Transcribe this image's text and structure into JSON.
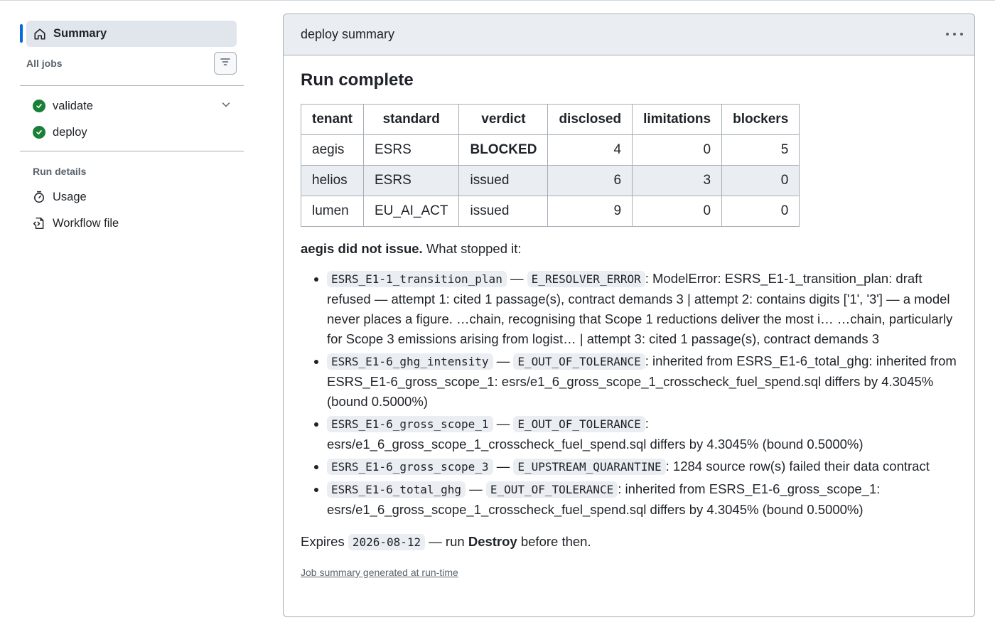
{
  "sidebar": {
    "summary_label": "Summary",
    "all_jobs_label": "All jobs",
    "jobs": [
      {
        "label": "validate",
        "status": "success"
      },
      {
        "label": "deploy",
        "status": "success"
      }
    ],
    "run_details_label": "Run details",
    "details": [
      {
        "label": "Usage",
        "icon": "stopwatch-icon"
      },
      {
        "label": "Workflow file",
        "icon": "file-code-icon"
      }
    ]
  },
  "card": {
    "title": "deploy summary",
    "heading": "Run complete",
    "table": {
      "headers": [
        "tenant",
        "standard",
        "verdict",
        "disclosed",
        "limitations",
        "blockers"
      ],
      "rows": [
        {
          "tenant": "aegis",
          "standard": "ESRS",
          "verdict": "BLOCKED",
          "disclosed": "4",
          "limitations": "0",
          "blockers": "5"
        },
        {
          "tenant": "helios",
          "standard": "ESRS",
          "verdict": "issued",
          "disclosed": "6",
          "limitations": "3",
          "blockers": "0"
        },
        {
          "tenant": "lumen",
          "standard": "EU_AI_ACT",
          "verdict": "issued",
          "disclosed": "9",
          "limitations": "0",
          "blockers": "0"
        }
      ]
    },
    "stopped_bold": "aegis did not issue.",
    "stopped_rest": " What stopped it:",
    "blockers": [
      {
        "code": "ESRS_E1-1_transition_plan",
        "sep": " — ",
        "error": "E_RESOLVER_ERROR",
        "message": ": ModelError: ESRS_E1-1_transition_plan: draft refused — attempt 1: cited 1 passage(s), contract demands 3 | attempt 2: contains digits ['1', '3'] — a model never places a figure. …chain, recognising that Scope 1 reductions deliver the most i… …chain, particularly for Scope 3 emissions arising from logist… | attempt 3: cited 1 passage(s), contract demands 3"
      },
      {
        "code": "ESRS_E1-6_ghg_intensity",
        "sep": " — ",
        "error": "E_OUT_OF_TOLERANCE",
        "message": ": inherited from ESRS_E1-6_total_ghg: inherited from ESRS_E1-6_gross_scope_1: esrs/e1_6_gross_scope_1_crosscheck_fuel_spend.sql differs by 4.3045% (bound 0.5000%)"
      },
      {
        "code": "ESRS_E1-6_gross_scope_1",
        "sep": " — ",
        "error": "E_OUT_OF_TOLERANCE",
        "message": ": esrs/e1_6_gross_scope_1_crosscheck_fuel_spend.sql differs by 4.3045% (bound 0.5000%)"
      },
      {
        "code": "ESRS_E1-6_gross_scope_3",
        "sep": " — ",
        "error": "E_UPSTREAM_QUARANTINE",
        "message": ": 1284 source row(s) failed their data contract"
      },
      {
        "code": "ESRS_E1-6_total_ghg",
        "sep": " — ",
        "error": "E_OUT_OF_TOLERANCE",
        "message": ": inherited from ESRS_E1-6_gross_scope_1: esrs/e1_6_gross_scope_1_crosscheck_fuel_spend.sql differs by 4.3045% (bound 0.5000%)"
      }
    ],
    "expires_prefix": "Expires ",
    "expires_date": "2026-08-12",
    "expires_mid": " — run ",
    "expires_bold": "Destroy",
    "expires_suffix": " before then.",
    "footer_link": "Job summary generated at run-time"
  },
  "colors": {
    "accent": "#0969da",
    "success": "#1a7f37",
    "header_bg": "#eaeef2",
    "border": "#a6adb5"
  }
}
